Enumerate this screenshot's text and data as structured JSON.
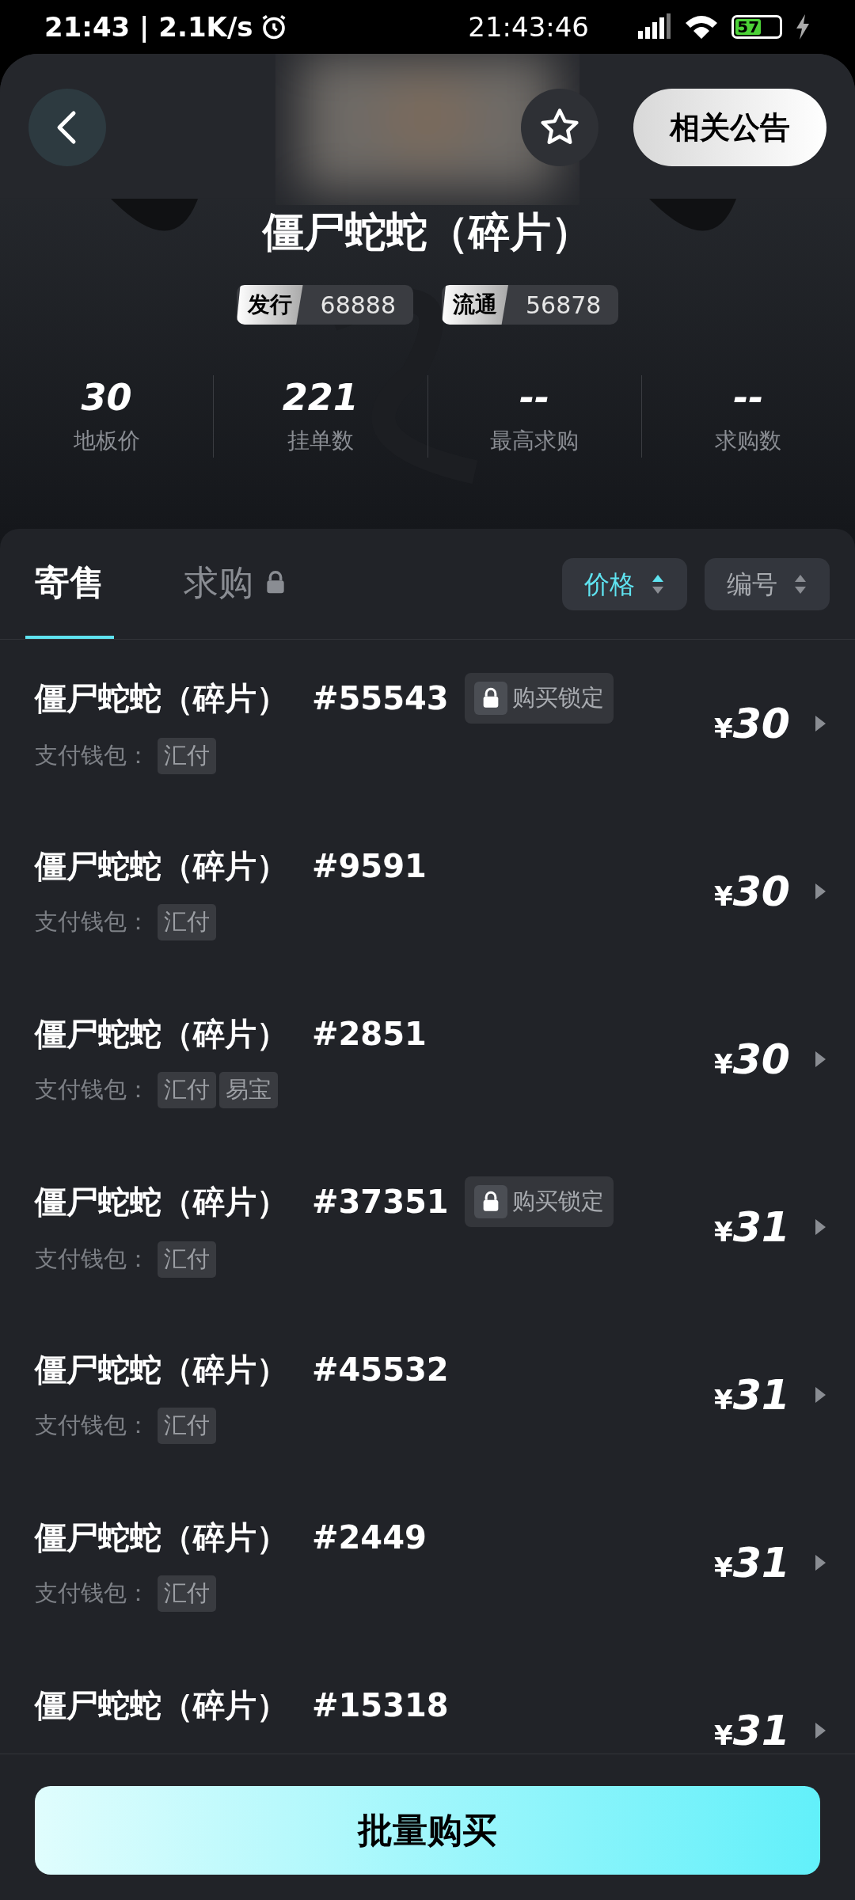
{
  "status_bar": {
    "left_text": "21:43 | 2.1K/s",
    "clock": "21:43:46",
    "battery": "57"
  },
  "header": {
    "announcement_button": "相关公告",
    "title": "僵尸蛇蛇（碎片）",
    "badges": [
      {
        "label": "发行",
        "value": "68888"
      },
      {
        "label": "流通",
        "value": "56878"
      }
    ],
    "stats": [
      {
        "value": "30",
        "label": "地板价"
      },
      {
        "value": "221",
        "label": "挂单数"
      },
      {
        "value": "--",
        "label": "最高求购"
      },
      {
        "value": "--",
        "label": "求购数"
      }
    ]
  },
  "tabs": [
    {
      "label": "寄售",
      "selected": true,
      "locked": false
    },
    {
      "label": "求购",
      "selected": false,
      "locked": true
    }
  ],
  "sort_buttons": [
    {
      "label": "价格",
      "active": true
    },
    {
      "label": "编号",
      "active": false
    }
  ],
  "listings": [
    {
      "name": "僵尸蛇蛇（碎片）",
      "number": "#55543",
      "lock_badge": "购买锁定",
      "wallet_label": "支付钱包：",
      "wallets": [
        "汇付"
      ],
      "currency": "¥",
      "price": "30"
    },
    {
      "name": "僵尸蛇蛇（碎片）",
      "number": "#9591",
      "wallet_label": "支付钱包：",
      "wallets": [
        "汇付"
      ],
      "currency": "¥",
      "price": "30"
    },
    {
      "name": "僵尸蛇蛇（碎片）",
      "number": "#2851",
      "wallet_label": "支付钱包：",
      "wallets": [
        "汇付",
        "易宝"
      ],
      "currency": "¥",
      "price": "30"
    },
    {
      "name": "僵尸蛇蛇（碎片）",
      "number": "#37351",
      "lock_badge": "购买锁定",
      "wallet_label": "支付钱包：",
      "wallets": [
        "汇付"
      ],
      "currency": "¥",
      "price": "31"
    },
    {
      "name": "僵尸蛇蛇（碎片）",
      "number": "#45532",
      "wallet_label": "支付钱包：",
      "wallets": [
        "汇付"
      ],
      "currency": "¥",
      "price": "31"
    },
    {
      "name": "僵尸蛇蛇（碎片）",
      "number": "#2449",
      "wallet_label": "支付钱包：",
      "wallets": [
        "汇付"
      ],
      "currency": "¥",
      "price": "31"
    },
    {
      "name": "僵尸蛇蛇（碎片）",
      "number": "#15318",
      "currency": "¥",
      "price": "31"
    }
  ],
  "bottom_button": "批量购买"
}
